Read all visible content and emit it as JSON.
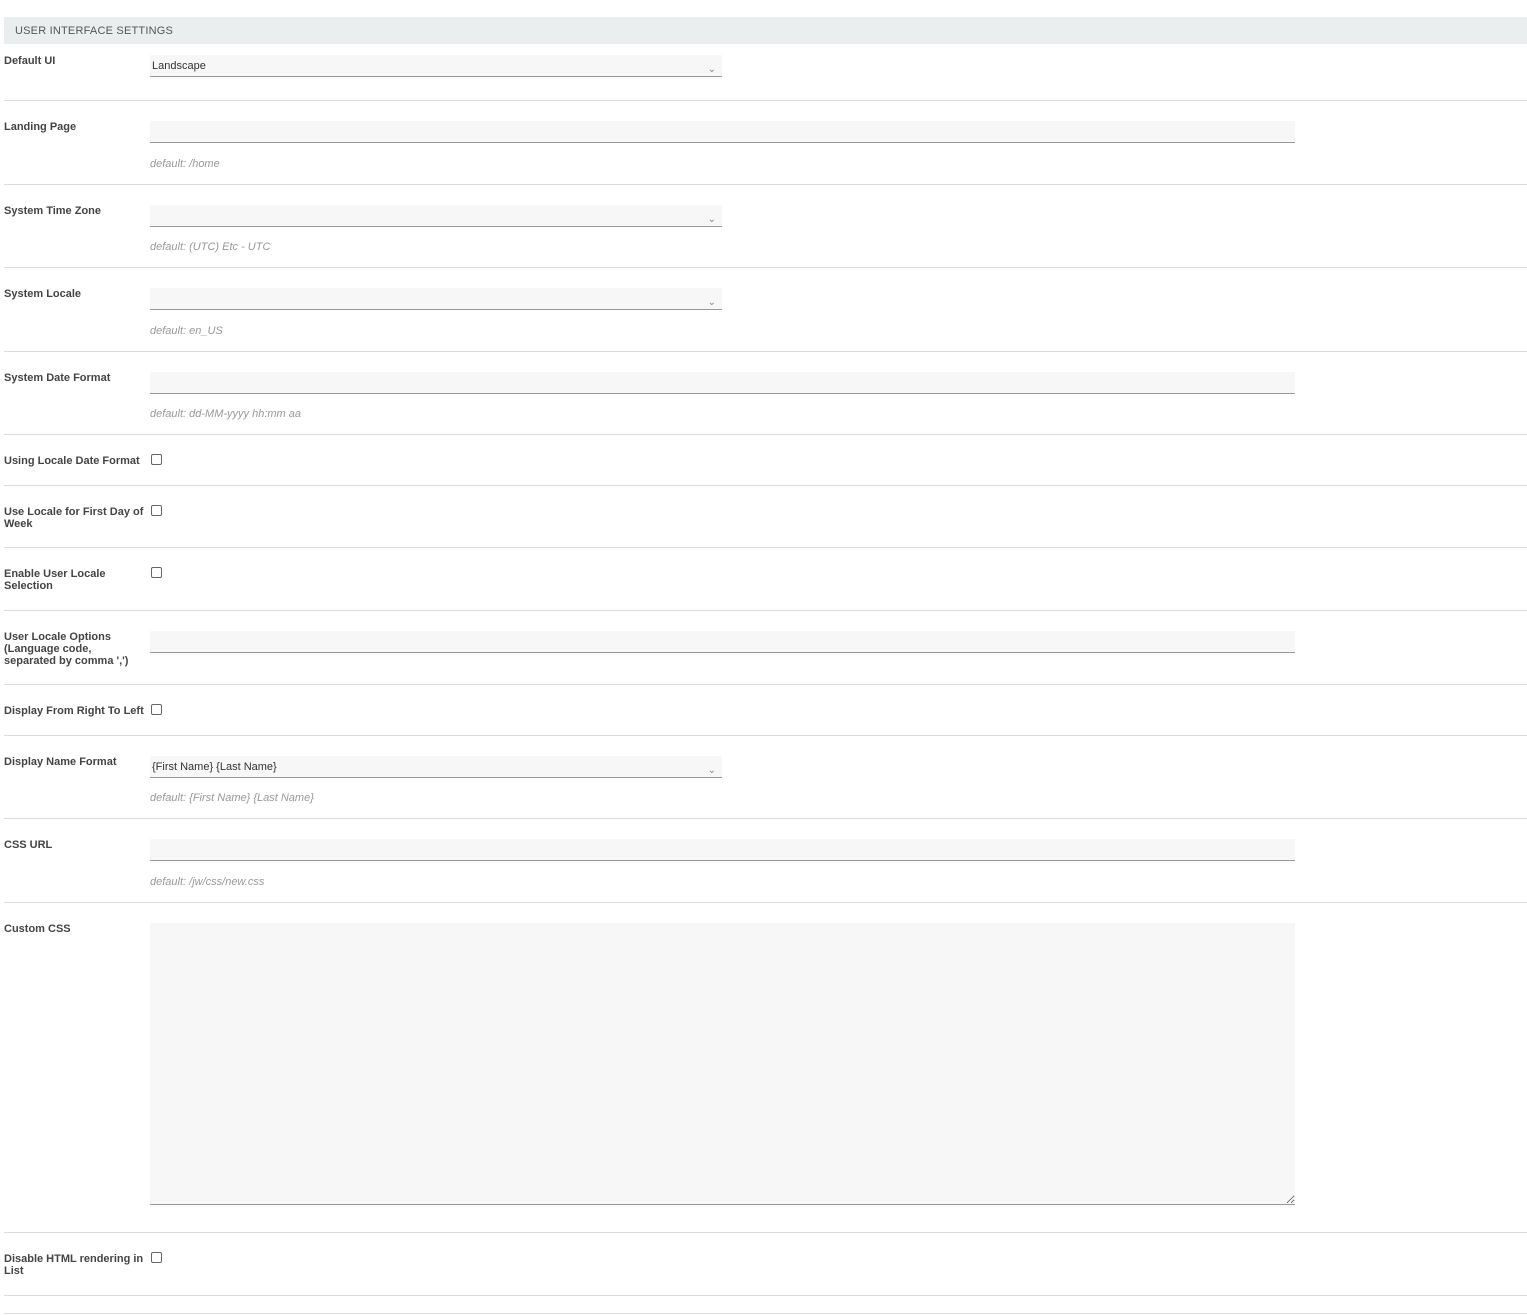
{
  "section_title": "USER INTERFACE SETTINGS",
  "fields": [
    {
      "label": "Default UI",
      "value": "Landscape"
    },
    {
      "label": "Landing Page",
      "value": "",
      "hint": "default: /home"
    },
    {
      "label": "System Time Zone",
      "value": "",
      "hint": "default: (UTC) Etc - UTC"
    },
    {
      "label": "System Locale",
      "value": "",
      "hint": "default: en_US"
    },
    {
      "label": "System Date Format",
      "value": "",
      "hint": "default: dd-MM-yyyy hh:mm aa"
    },
    {
      "label": "Using Locale Date Format",
      "checked": false
    },
    {
      "label": "Use Locale for First Day of Week",
      "checked": false
    },
    {
      "label": "Enable User Locale Selection",
      "checked": false
    },
    {
      "label": "User Locale Options (Language code, separated by comma ',')",
      "value": ""
    },
    {
      "label": "Display From Right To Left",
      "checked": false
    },
    {
      "label": "Display Name Format",
      "value": "{First Name} {Last Name}",
      "hint": "default: {First Name} {Last Name}"
    },
    {
      "label": "CSS URL",
      "value": "",
      "hint": "default: /jw/css/new.css"
    },
    {
      "label": "Custom CSS",
      "value": ""
    },
    {
      "label": "Disable HTML rendering in List",
      "checked": false
    }
  ]
}
